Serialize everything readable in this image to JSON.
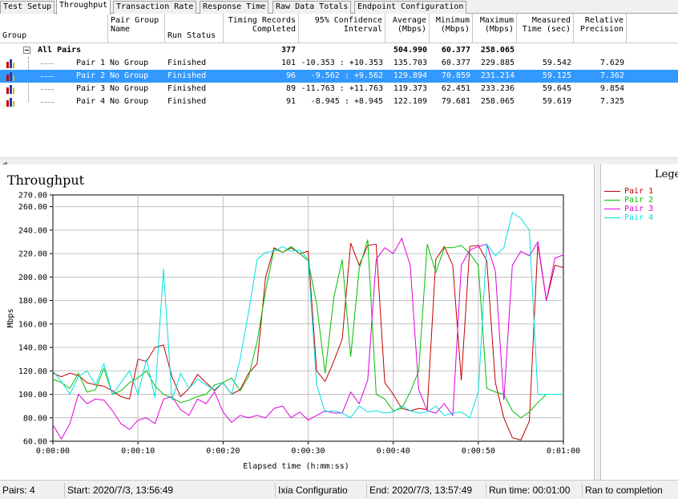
{
  "tabs": [
    {
      "label": "Test Setup",
      "active": false
    },
    {
      "label": "Throughput",
      "active": true
    },
    {
      "label": "Transaction Rate",
      "active": false
    },
    {
      "label": "Response Time",
      "active": false
    },
    {
      "label": "Raw Data Totals",
      "active": false
    },
    {
      "label": "Endpoint Configuration",
      "active": false
    }
  ],
  "grid": {
    "headers": {
      "group": [
        "Group"
      ],
      "pair_group_name": [
        "Pair Group",
        "Name"
      ],
      "run_status": [
        "Run Status"
      ],
      "timing_records": [
        "Timing Records",
        "Completed"
      ],
      "confidence": [
        "95% Confidence",
        "Interval"
      ],
      "average": [
        "Average",
        "(Mbps)"
      ],
      "minimum": [
        "Minimum",
        "(Mbps)"
      ],
      "maximum": [
        "Maximum",
        "(Mbps)"
      ],
      "measured_time": [
        "Measured",
        "Time (sec)"
      ],
      "precision": [
        "Relative",
        "Precision"
      ]
    },
    "all_pairs": {
      "label": "All Pairs",
      "records": "377",
      "average": "504.990",
      "minimum": "60.377",
      "maximum": "258.065"
    },
    "rows": [
      {
        "pair": "Pair 1",
        "group": "No Group",
        "status": "Finished",
        "records": "101",
        "ci": "-10.353 : +10.353",
        "avg": "135.703",
        "min": "60.377",
        "max": "229.885",
        "time": "59.542",
        "prec": "7.629",
        "selected": false
      },
      {
        "pair": "Pair 2",
        "group": "No Group",
        "status": "Finished",
        "records": "96",
        "ci": "-9.562 : +9.562",
        "avg": "129.894",
        "min": "70.859",
        "max": "231.214",
        "time": "59.125",
        "prec": "7.362",
        "selected": true
      },
      {
        "pair": "Pair 3",
        "group": "No Group",
        "status": "Finished",
        "records": "89",
        "ci": "-11.763 : +11.763",
        "avg": "119.373",
        "min": "62.451",
        "max": "233.236",
        "time": "59.645",
        "prec": "9.854",
        "selected": false
      },
      {
        "pair": "Pair 4",
        "group": "No Group",
        "status": "Finished",
        "records": "91",
        "ci": "-8.945 : +8.945",
        "avg": "122.109",
        "min": "79.681",
        "max": "258.065",
        "time": "59.619",
        "prec": "7.325",
        "selected": false
      }
    ]
  },
  "chart_data": {
    "type": "line",
    "title": "Throughput",
    "xlabel": "Elapsed time (h:mm:ss)",
    "ylabel": "Mbps",
    "xlim": [
      0,
      60
    ],
    "ylim": [
      60,
      270
    ],
    "grid": true,
    "legend_position": "right",
    "x_ticks": [
      "0:00:00",
      "0:00:10",
      "0:00:20",
      "0:00:30",
      "0:00:40",
      "0:00:50",
      "0:01:00"
    ],
    "y_ticks": [
      "60.00",
      "80.00",
      "100.00",
      "120.00",
      "140.00",
      "160.00",
      "180.00",
      "200.00",
      "220.00",
      "240.00",
      "260.00",
      "270.00"
    ],
    "series": [
      {
        "name": "Pair 1",
        "color": "#c00000",
        "points": [
          [
            0,
            118
          ],
          [
            1,
            115
          ],
          [
            2,
            118
          ],
          [
            3,
            116
          ],
          [
            4,
            110
          ],
          [
            5,
            108
          ],
          [
            6,
            107
          ],
          [
            7,
            103
          ],
          [
            8,
            98
          ],
          [
            9,
            96
          ],
          [
            10,
            130
          ],
          [
            11,
            128
          ],
          [
            12,
            140
          ],
          [
            13,
            142
          ],
          [
            14,
            115
          ],
          [
            15,
            98
          ],
          [
            16,
            105
          ],
          [
            17,
            117
          ],
          [
            18,
            110
          ],
          [
            19,
            103
          ],
          [
            20,
            110
          ],
          [
            21,
            100
          ],
          [
            22,
            104
          ],
          [
            23,
            118
          ],
          [
            24,
            126
          ],
          [
            25,
            200
          ],
          [
            26,
            225
          ],
          [
            27,
            221
          ],
          [
            28,
            225
          ],
          [
            29,
            220
          ],
          [
            30,
            222
          ],
          [
            31,
            120
          ],
          [
            32,
            111
          ],
          [
            33,
            128
          ],
          [
            34,
            147
          ],
          [
            35,
            229
          ],
          [
            36,
            210
          ],
          [
            37,
            227
          ],
          [
            38,
            228
          ],
          [
            39,
            110
          ],
          [
            40,
            100
          ],
          [
            41,
            88
          ],
          [
            42,
            86
          ],
          [
            43,
            88
          ],
          [
            44,
            87
          ],
          [
            45,
            215
          ],
          [
            46,
            226
          ],
          [
            47,
            210
          ],
          [
            48,
            112
          ],
          [
            49,
            226
          ],
          [
            50,
            227
          ],
          [
            51,
            214
          ],
          [
            52,
            110
          ],
          [
            53,
            80
          ],
          [
            54,
            63
          ],
          [
            55,
            61
          ],
          [
            56,
            77
          ],
          [
            57,
            228
          ],
          [
            58,
            180
          ],
          [
            59,
            210
          ],
          [
            60,
            208
          ]
        ]
      },
      {
        "name": "Pair 2",
        "color": "#00c000",
        "points": [
          [
            0,
            113
          ],
          [
            1,
            110
          ],
          [
            2,
            105
          ],
          [
            3,
            118
          ],
          [
            4,
            102
          ],
          [
            5,
            104
          ],
          [
            6,
            122
          ],
          [
            7,
            100
          ],
          [
            8,
            103
          ],
          [
            9,
            110
          ],
          [
            10,
            114
          ],
          [
            11,
            120
          ],
          [
            12,
            107
          ],
          [
            13,
            100
          ],
          [
            14,
            97
          ],
          [
            15,
            93
          ],
          [
            16,
            95
          ],
          [
            17,
            98
          ],
          [
            18,
            100
          ],
          [
            19,
            108
          ],
          [
            20,
            110
          ],
          [
            21,
            114
          ],
          [
            22,
            103
          ],
          [
            23,
            115
          ],
          [
            24,
            145
          ],
          [
            25,
            188
          ],
          [
            26,
            224
          ],
          [
            27,
            221
          ],
          [
            28,
            226
          ],
          [
            29,
            220
          ],
          [
            30,
            214
          ],
          [
            31,
            177
          ],
          [
            32,
            118
          ],
          [
            33,
            182
          ],
          [
            34,
            215
          ],
          [
            35,
            132
          ],
          [
            36,
            207
          ],
          [
            37,
            232
          ],
          [
            38,
            100
          ],
          [
            39,
            96
          ],
          [
            40,
            86
          ],
          [
            41,
            88
          ],
          [
            42,
            102
          ],
          [
            43,
            120
          ],
          [
            44,
            228
          ],
          [
            45,
            204
          ],
          [
            46,
            225
          ],
          [
            47,
            225
          ],
          [
            48,
            227
          ],
          [
            49,
            220
          ],
          [
            50,
            210
          ],
          [
            51,
            105
          ],
          [
            52,
            102
          ],
          [
            53,
            100
          ],
          [
            54,
            86
          ],
          [
            55,
            80
          ],
          [
            56,
            85
          ],
          [
            57,
            93
          ],
          [
            58,
            100
          ],
          [
            59,
            100
          ],
          [
            60,
            100
          ]
        ]
      },
      {
        "name": "Pair 3",
        "color": "#e000e0",
        "points": [
          [
            0,
            74
          ],
          [
            1,
            62
          ],
          [
            2,
            75
          ],
          [
            3,
            100
          ],
          [
            4,
            92
          ],
          [
            5,
            96
          ],
          [
            6,
            95
          ],
          [
            7,
            86
          ],
          [
            8,
            75
          ],
          [
            9,
            70
          ],
          [
            10,
            78
          ],
          [
            11,
            80
          ],
          [
            12,
            75
          ],
          [
            13,
            96
          ],
          [
            14,
            98
          ],
          [
            15,
            87
          ],
          [
            16,
            82
          ],
          [
            17,
            96
          ],
          [
            18,
            92
          ],
          [
            19,
            102
          ],
          [
            20,
            85
          ],
          [
            21,
            76
          ],
          [
            22,
            82
          ],
          [
            23,
            80
          ],
          [
            24,
            82
          ],
          [
            25,
            80
          ],
          [
            26,
            88
          ],
          [
            27,
            90
          ],
          [
            28,
            80
          ],
          [
            29,
            85
          ],
          [
            30,
            78
          ],
          [
            31,
            82
          ],
          [
            32,
            86
          ],
          [
            33,
            84
          ],
          [
            34,
            84
          ],
          [
            35,
            102
          ],
          [
            36,
            92
          ],
          [
            37,
            112
          ],
          [
            38,
            215
          ],
          [
            39,
            225
          ],
          [
            40,
            220
          ],
          [
            41,
            233
          ],
          [
            42,
            210
          ],
          [
            43,
            104
          ],
          [
            44,
            86
          ],
          [
            45,
            84
          ],
          [
            46,
            92
          ],
          [
            47,
            82
          ],
          [
            48,
            210
          ],
          [
            49,
            223
          ],
          [
            50,
            226
          ],
          [
            51,
            228
          ],
          [
            52,
            205
          ],
          [
            53,
            95
          ],
          [
            54,
            210
          ],
          [
            55,
            222
          ],
          [
            56,
            218
          ],
          [
            57,
            230
          ],
          [
            58,
            180
          ],
          [
            59,
            216
          ],
          [
            60,
            219
          ]
        ]
      },
      {
        "name": "Pair 4",
        "color": "#00e0e0",
        "points": [
          [
            0,
            120
          ],
          [
            1,
            111
          ],
          [
            2,
            100
          ],
          [
            3,
            115
          ],
          [
            4,
            120
          ],
          [
            5,
            108
          ],
          [
            6,
            126
          ],
          [
            7,
            100
          ],
          [
            8,
            110
          ],
          [
            9,
            120
          ],
          [
            10,
            100
          ],
          [
            11,
            130
          ],
          [
            12,
            97
          ],
          [
            13,
            207
          ],
          [
            14,
            95
          ],
          [
            15,
            118
          ],
          [
            16,
            105
          ],
          [
            17,
            113
          ],
          [
            18,
            108
          ],
          [
            19,
            104
          ],
          [
            20,
            110
          ],
          [
            21,
            100
          ],
          [
            22,
            130
          ],
          [
            23,
            170
          ],
          [
            24,
            215
          ],
          [
            25,
            221
          ],
          [
            26,
            222
          ],
          [
            27,
            226
          ],
          [
            28,
            222
          ],
          [
            29,
            223
          ],
          [
            30,
            215
          ],
          [
            31,
            108
          ],
          [
            32,
            85
          ],
          [
            33,
            86
          ],
          [
            34,
            84
          ],
          [
            35,
            80
          ],
          [
            36,
            90
          ],
          [
            37,
            85
          ],
          [
            38,
            86
          ],
          [
            39,
            84
          ],
          [
            40,
            85
          ],
          [
            41,
            90
          ],
          [
            42,
            86
          ],
          [
            43,
            84
          ],
          [
            44,
            85
          ],
          [
            45,
            90
          ],
          [
            46,
            82
          ],
          [
            47,
            84
          ],
          [
            48,
            85
          ],
          [
            49,
            80
          ],
          [
            50,
            102
          ],
          [
            51,
            228
          ],
          [
            52,
            218
          ],
          [
            53,
            225
          ],
          [
            54,
            255
          ],
          [
            55,
            250
          ],
          [
            56,
            240
          ],
          [
            57,
            100
          ],
          [
            58,
            100
          ],
          [
            59,
            100
          ],
          [
            60,
            100
          ]
        ]
      }
    ]
  },
  "legend": {
    "title": "Legend"
  },
  "status": {
    "pairs": "Pairs: 4",
    "start": "Start: 2020/7/3, 13:56:49",
    "config": "Ixia Configuratio",
    "end": "End: 2020/7/3, 13:57:49",
    "runtime": "Run time: 00:01:00",
    "result": "Ran to completion"
  }
}
